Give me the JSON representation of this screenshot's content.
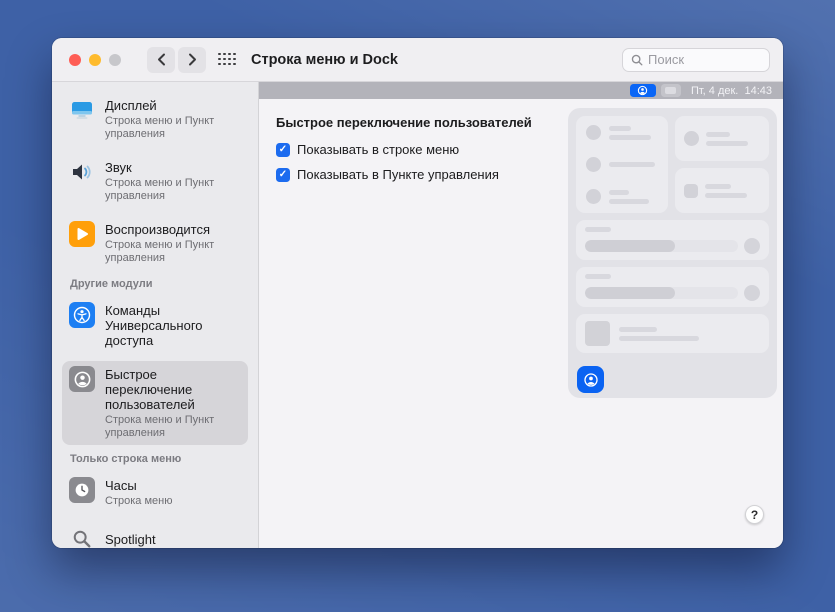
{
  "window": {
    "title": "Строка меню и Dock",
    "search_placeholder": "Поиск",
    "help_label": "?"
  },
  "glyphs": {
    "check": "✓"
  },
  "sidebar": {
    "sections": {
      "other_modules": "Другие модули",
      "menu_bar_only": "Только строка меню"
    },
    "items": [
      {
        "label": "Дисплей",
        "subtitle": "Строка меню и Пункт управления",
        "icon": "display-icon",
        "selected": false
      },
      {
        "label": "Звук",
        "subtitle": "Строка меню и Пункт управления",
        "icon": "sound-icon",
        "selected": false
      },
      {
        "label": "Воспроизводится",
        "subtitle": "Строка меню и Пункт управления",
        "icon": "now-playing-icon",
        "selected": false
      },
      {
        "label": "Команды Универсального доступа",
        "subtitle": "",
        "icon": "accessibility-icon",
        "selected": false
      },
      {
        "label": "Быстрое переключение пользователей",
        "subtitle": "Строка меню и Пункт управления",
        "icon": "fast-user-switching-icon",
        "selected": true
      },
      {
        "label": "Часы",
        "subtitle": "Строка меню",
        "icon": "clock-icon",
        "selected": false
      },
      {
        "label": "Spotlight",
        "subtitle": "",
        "icon": "spotlight-icon",
        "selected": false
      }
    ]
  },
  "main": {
    "heading": "Быстрое переключение пользователей",
    "checkboxes": [
      {
        "label": "Показывать в строке меню",
        "checked": true
      },
      {
        "label": "Показывать в Пункте управления",
        "checked": true
      }
    ]
  },
  "menubar_preview": {
    "datetime": "Пт, 4 дек.  14:43",
    "active_icon": "fast-user-switching-icon",
    "dimmed_icon": "display-menu-icon"
  },
  "colors": {
    "accent_blue": "#0a66f6",
    "checkbox_blue": "#1c6bef",
    "desktop_blue": "#3e61a6",
    "menubar_gray": "#b3b3ba",
    "selected_item_gray": "#d6d5d9"
  }
}
